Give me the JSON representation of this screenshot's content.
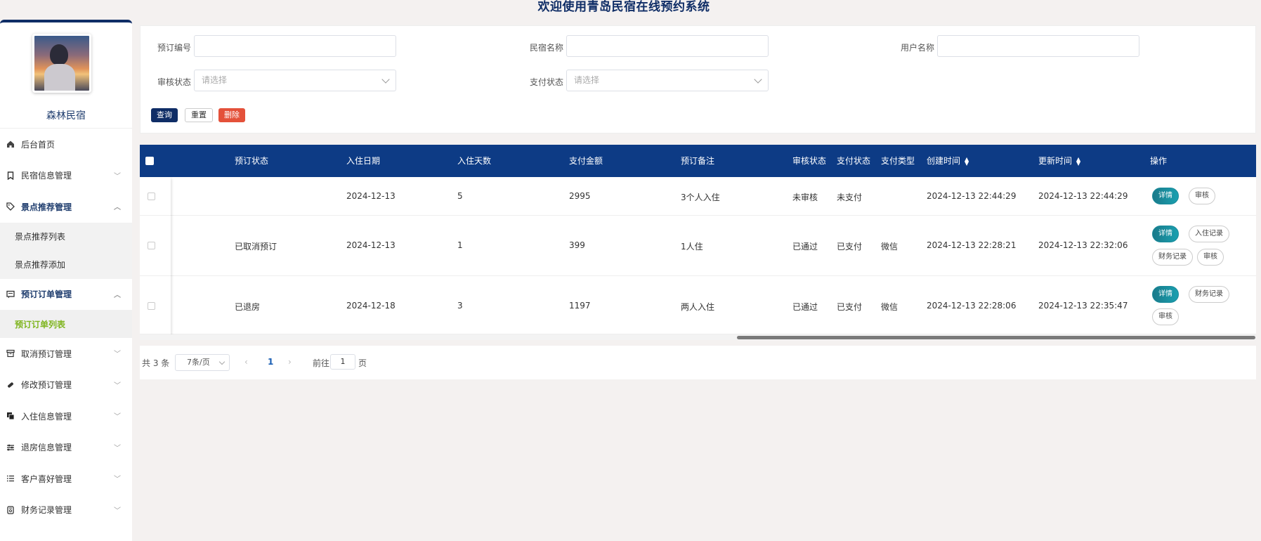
{
  "app": {
    "title": "欢迎使用青岛民宿在线预约系统"
  },
  "sidebar": {
    "brand": "森林民宿",
    "items": [
      {
        "label": "后台首页",
        "icon": "home-icon"
      },
      {
        "label": "民宿信息管理",
        "icon": "bookmark-icon"
      },
      {
        "label": "景点推荐管理",
        "icon": "tag-icon"
      },
      {
        "label": "预订订单管理",
        "icon": "message-icon"
      },
      {
        "label": "取消预订管理",
        "icon": "archive-icon"
      },
      {
        "label": "修改预订管理",
        "icon": "paperclip-icon"
      },
      {
        "label": "入住信息管理",
        "icon": "copy-icon"
      },
      {
        "label": "退房信息管理",
        "icon": "sliders-icon"
      },
      {
        "label": "客户喜好管理",
        "icon": "list-icon"
      },
      {
        "label": "财务记录管理",
        "icon": "wallet-icon"
      }
    ],
    "sub_scenic": [
      "景点推荐列表",
      "景点推荐添加"
    ],
    "sub_orders": [
      "预订订单列表"
    ]
  },
  "filters": {
    "order_no_label": "预订编号",
    "homestay_label": "民宿名称",
    "username_label": "用户名称",
    "audit_label": "审核状态",
    "audit_placeholder": "请选择",
    "pay_label": "支付状态",
    "pay_placeholder": "请选择",
    "query": "查询",
    "reset": "重置",
    "delete": "删除"
  },
  "table": {
    "headers": {
      "status": "预订状态",
      "checkin": "入住日期",
      "days": "入住天数",
      "amount": "支付金额",
      "remark": "预订备注",
      "audit": "审核状态",
      "pay": "支付状态",
      "paytype": "支付类型",
      "created": "创建时间",
      "updated": "更新时间",
      "ops": "操作"
    },
    "rows": [
      {
        "status": "",
        "checkin": "2024-12-13",
        "days": "5",
        "amount": "2995",
        "remark": "3个人入住",
        "audit": "未审核",
        "pay": "未支付",
        "paytype": "",
        "created": "2024-12-13 22:44:29",
        "updated": "2024-12-13 22:44:29",
        "ops": [
          "详情",
          "审核"
        ]
      },
      {
        "status": "已取消预订",
        "checkin": "2024-12-13",
        "days": "1",
        "amount": "399",
        "remark": "1人住",
        "audit": "已通过",
        "pay": "已支付",
        "paytype": "微信",
        "created": "2024-12-13 22:28:21",
        "updated": "2024-12-13 22:32:06",
        "ops": [
          "详情",
          "入住记录",
          "财务记录",
          "审核"
        ]
      },
      {
        "status": "已退房",
        "checkin": "2024-12-18",
        "days": "3",
        "amount": "1197",
        "remark": "两人入住",
        "audit": "已通过",
        "pay": "已支付",
        "paytype": "微信",
        "created": "2024-12-13 22:28:06",
        "updated": "2024-12-13 22:35:47",
        "ops": [
          "详情",
          "财务记录",
          "审核"
        ]
      }
    ]
  },
  "pager": {
    "total": "共 3 条",
    "page_size": "7条/页",
    "prev": "‹",
    "current": "1",
    "next": "›",
    "goto": "前往",
    "goto_value": "1",
    "page_unit": "页"
  }
}
